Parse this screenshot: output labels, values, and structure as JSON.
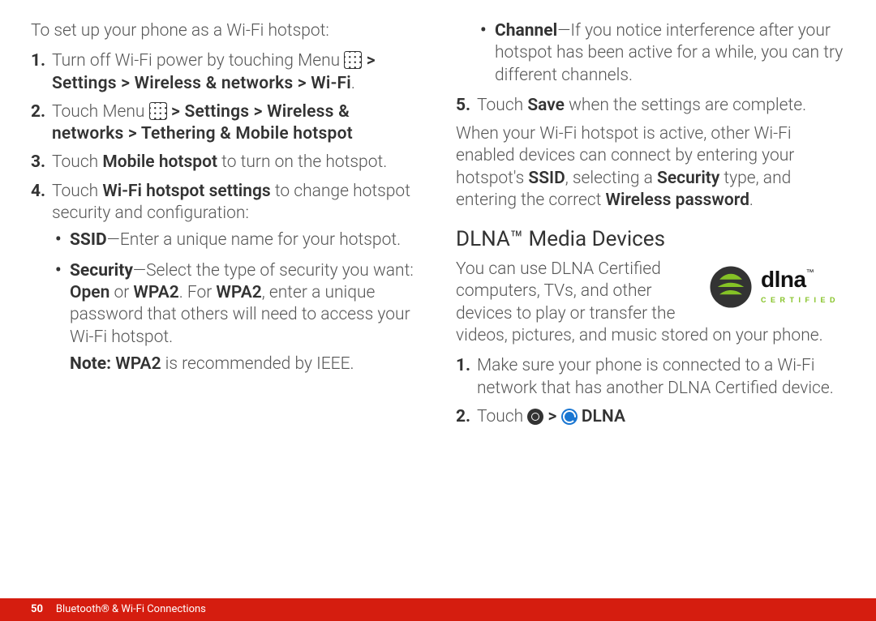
{
  "col1": {
    "intro": "To set up your phone as a Wi-Fi hotspot:",
    "step1_a": "Turn off Wi-Fi power by touching Menu ",
    "step1_b_gt": " > ",
    "step1_path": "Settings > Wireless & networks > Wi-Fi",
    "step1_end": ".",
    "step2_a": "Touch Menu ",
    "step2_b_gt": " > ",
    "step2_path": "Settings > Wireless & networks > Tethering & Mobile hotspot",
    "step3_a": "Touch ",
    "step3_b": "Mobile hotspot",
    "step3_c": " to turn on the hotspot.",
    "step4_a": "Touch ",
    "step4_b": "Wi-Fi hotspot settings",
    "step4_c": " to change hotspot security and configuration:",
    "bullet_ssid_a": "SSID",
    "bullet_ssid_b": "—Enter a unique name for your hotspot.",
    "bullet_sec_a": "Security",
    "bullet_sec_b": "—Select the type of security you want: ",
    "bullet_sec_open": "Open",
    "bullet_sec_or": " or ",
    "bullet_sec_wpa2": "WPA2",
    "bullet_sec_c": ". For ",
    "bullet_sec_wpa2b": "WPA2",
    "bullet_sec_d": ", enter a unique password that others will need to access your Wi-Fi hotspot.",
    "note_a": "Note: ",
    "note_b": "WPA2",
    "note_c": " is recommended by IEEE."
  },
  "col2": {
    "bullet_ch_a": "Channel",
    "bullet_ch_b": "—If you notice interference after your hotspot has been active for a while, you can try different channels.",
    "step5_a": "Touch ",
    "step5_b": "Save",
    "step5_c": " when the settings are complete.",
    "after_a": "When your Wi-Fi hotspot is active, other Wi-Fi enabled devices can connect by entering your hotspot's ",
    "after_ssid": "SSID",
    "after_b": ", selecting a ",
    "after_sec": "Security",
    "after_c": " type, and entering the correct ",
    "after_pw": "Wireless password",
    "after_d": ".",
    "heading": "DLNA™ Media Devices",
    "dlna_para": "You can use DLNA Certified computers, TVs, and other devices to play or transfer the videos, pictures, and music stored on your phone.",
    "dlna_step1": "Make sure your phone is connected to a Wi-Fi network that has another DLNA Certified device.",
    "dlna_step2_a": "Touch ",
    "dlna_step2_b": " > ",
    "dlna_step2_c": " DLNA",
    "logo_brand": "dlna",
    "logo_cert": "C E R T I F I E D"
  },
  "footer": {
    "page": "50",
    "section": "Bluetooth® & Wi-Fi Connections"
  }
}
